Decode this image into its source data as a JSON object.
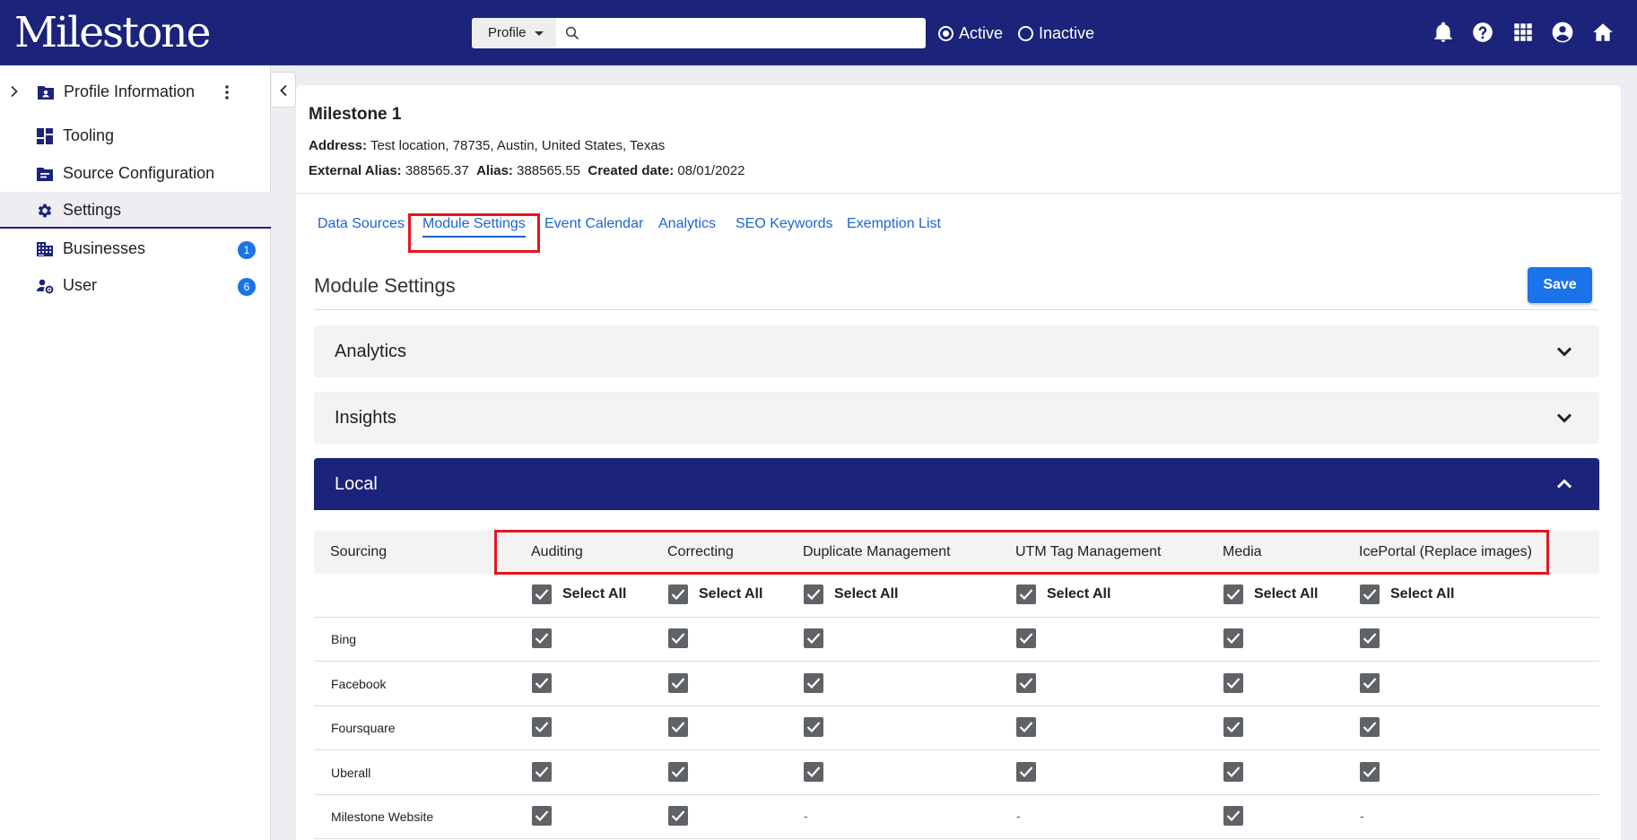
{
  "brand": {
    "logo": "Milestone"
  },
  "search": {
    "dropdown": "Profile",
    "placeholder": "",
    "value": ""
  },
  "status_filter": {
    "active": "Active",
    "inactive": "Inactive",
    "selected": "Active"
  },
  "topbar_icons": [
    "bell-icon",
    "help-icon",
    "apps-grid-icon",
    "account-icon",
    "home-icon"
  ],
  "sidebar": {
    "items": [
      {
        "label": "Profile Information",
        "icon": "profile-folder-icon"
      },
      {
        "label": "Tooling",
        "icon": "dashboard-icon"
      },
      {
        "label": "Source Configuration",
        "icon": "source-config-icon"
      },
      {
        "label": "Settings",
        "icon": "gear-icon",
        "active": true
      },
      {
        "label": "Businesses",
        "icon": "business-icon",
        "badge": "1"
      },
      {
        "label": "User",
        "icon": "user-settings-icon",
        "badge": "6"
      }
    ]
  },
  "profile": {
    "name": "Milestone 1",
    "address_label": "Address:",
    "address": "Test location, 78735, Austin, United States, Texas",
    "external_alias_label": "External Alias:",
    "external_alias": "388565.37",
    "alias_label": "Alias:",
    "alias": "388565.55",
    "created_label": "Created date:",
    "created": "08/01/2022"
  },
  "tabs": [
    "Data Sources",
    "Module Settings",
    "Event Calendar",
    "Analytics",
    "SEO Keywords",
    "Exemption List"
  ],
  "active_tab": "Module Settings",
  "section": {
    "title": "Module Settings",
    "save": "Save"
  },
  "accordions": [
    {
      "label": "Analytics",
      "expanded": false
    },
    {
      "label": "Insights",
      "expanded": false
    },
    {
      "label": "Local",
      "expanded": true
    }
  ],
  "table": {
    "first_column": "Sourcing",
    "columns": [
      "Auditing",
      "Correcting",
      "Duplicate Management",
      "UTM Tag Management",
      "Media",
      "IcePortal (Replace images)"
    ],
    "select_all": "Select All",
    "rows": [
      {
        "name": "Bing",
        "values": [
          "checked",
          "checked",
          "checked",
          "checked",
          "checked",
          "checked"
        ]
      },
      {
        "name": "Facebook",
        "values": [
          "checked",
          "checked",
          "checked",
          "checked",
          "checked",
          "checked"
        ]
      },
      {
        "name": "Foursquare",
        "values": [
          "checked",
          "checked",
          "checked",
          "checked",
          "checked",
          "checked"
        ]
      },
      {
        "name": "Uberall",
        "values": [
          "checked",
          "checked",
          "checked",
          "checked",
          "checked",
          "checked"
        ]
      },
      {
        "name": "Milestone Website",
        "values": [
          "checked",
          "checked",
          "-",
          "-",
          "checked",
          "-"
        ]
      }
    ]
  },
  "colors": {
    "header": "#1b237a",
    "primary": "#1a73e8",
    "link": "#1a66d2",
    "highlight": "#e8141c",
    "checkbox": "#5f6368"
  }
}
